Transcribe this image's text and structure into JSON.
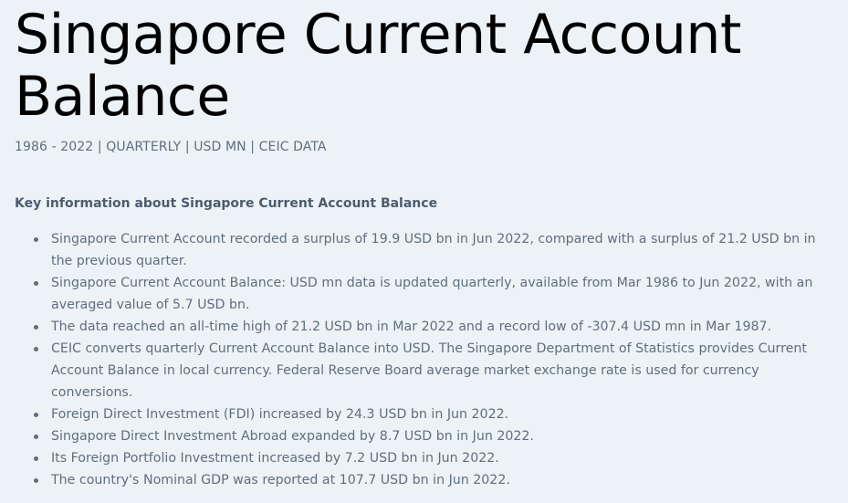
{
  "page": {
    "title": "Singapore Current Account Balance",
    "subtitle": "1986 - 2022 | QUARTERLY | USD MN | CEIC DATA"
  },
  "key_info": {
    "heading": "Key information about Singapore Current Account Balance",
    "items": [
      "Singapore Current Account recorded a surplus of 19.9 USD bn in Jun 2022, compared with a surplus of 21.2 USD bn in the previous quarter.",
      "Singapore Current Account Balance: USD mn data is updated quarterly, available from Mar 1986 to Jun 2022, with an averaged value of 5.7 USD bn.",
      "The data reached an all-time high of 21.2 USD bn in Mar 2022 and a record low of -307.4 USD mn in Mar 1987.",
      "CEIC converts quarterly Current Account Balance into USD. The Singapore Department of Statistics provides Current Account Balance in local currency. Federal Reserve Board average market exchange rate is used for currency conversions.",
      "Foreign Direct Investment (FDI) increased by 24.3 USD bn in Jun 2022.",
      "Singapore Direct Investment Abroad expanded by 8.7 USD bn in Jun 2022.",
      "Its Foreign Portfolio Investment increased by 7.2 USD bn in Jun 2022.",
      "The country's Nominal GDP was reported at 107.7 USD bn in Jun 2022."
    ]
  }
}
